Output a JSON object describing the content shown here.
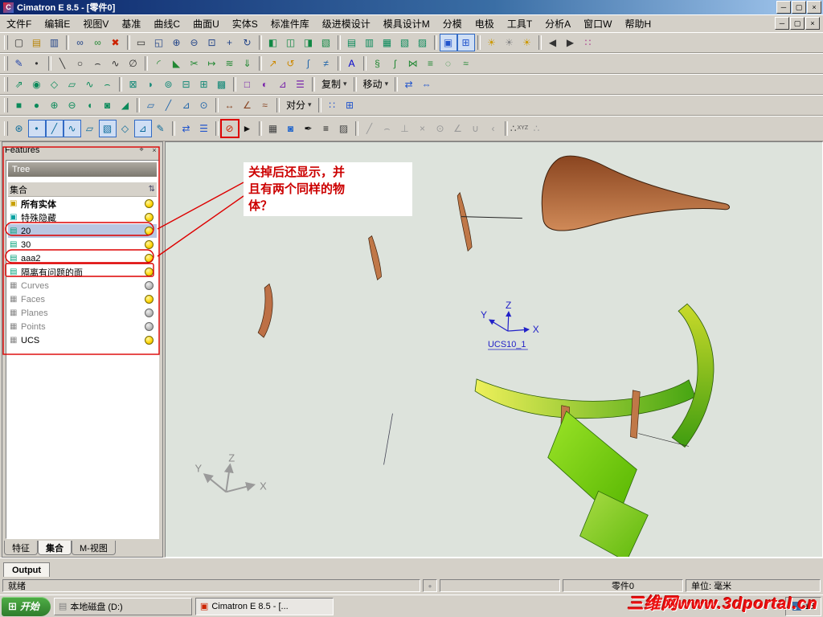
{
  "window": {
    "title": "Cimatron E 8.5 - [零件0]",
    "app_initial": "C"
  },
  "menu": {
    "items": [
      "文件F",
      "编辑E",
      "视图V",
      "基准",
      "曲线C",
      "曲面U",
      "实体S",
      "标准件库",
      "级进模设计",
      "模具设计M",
      "分模",
      "电极",
      "工具T",
      "分析A",
      "窗口W",
      "帮助H"
    ]
  },
  "toolbars": {
    "copy_label": "复制",
    "move_label": "移动",
    "split_label": "对分",
    "row1": [
      {
        "n": "new-file-icon",
        "g": "▢",
        "c": "#333"
      },
      {
        "n": "open-folder-icon",
        "g": "▤",
        "c": "#b8860b"
      },
      {
        "n": "save-icon",
        "g": "▥",
        "c": "#224488"
      },
      {
        "sep": 1
      },
      {
        "n": "link-views-icon",
        "g": "∞",
        "c": "#224488"
      },
      {
        "n": "link-edit-icon",
        "g": "∞",
        "c": "#228833"
      },
      {
        "n": "delete-red-icon",
        "g": "✖",
        "c": "#cc2200"
      },
      {
        "sep": 1
      },
      {
        "n": "select-window-icon",
        "g": "▭",
        "c": "#333"
      },
      {
        "n": "zoom-window-icon",
        "g": "◱",
        "c": "#224488"
      },
      {
        "n": "zoom-in-icon",
        "g": "⊕",
        "c": "#224488"
      },
      {
        "n": "zoom-out-icon",
        "g": "⊖",
        "c": "#224488"
      },
      {
        "n": "zoom-fit-icon",
        "g": "⊡",
        "c": "#224488"
      },
      {
        "n": "pan-icon",
        "g": "+",
        "c": "#224488"
      },
      {
        "n": "rotate-view-icon",
        "g": "↻",
        "c": "#224488"
      },
      {
        "sep": 1
      },
      {
        "n": "shaded-display-icon",
        "g": "◧",
        "c": "#118844"
      },
      {
        "n": "wireframe-display-icon",
        "g": "◫",
        "c": "#118844"
      },
      {
        "n": "hidden-line-display-icon",
        "g": "◨",
        "c": "#118844"
      },
      {
        "n": "perspective-display-icon",
        "g": "▧",
        "c": "#118844"
      },
      {
        "sep": 1
      },
      {
        "n": "part-file-icon",
        "g": "▤",
        "c": "#0a8a5a"
      },
      {
        "n": "assembly-file-icon",
        "g": "▥",
        "c": "#0a8a5a"
      },
      {
        "n": "drawing-file-icon",
        "g": "▦",
        "c": "#0a8a5a"
      },
      {
        "n": "nc-file-icon",
        "g": "▧",
        "c": "#0a8a5a"
      },
      {
        "n": "electrode-file-icon",
        "g": "▨",
        "c": "#0a8a5a"
      },
      {
        "sep": 1
      },
      {
        "n": "single-viewport-icon",
        "g": "▣",
        "c": "#2255cc",
        "a": 1
      },
      {
        "n": "multi-viewport-icon",
        "g": "⊞",
        "c": "#2255cc",
        "a": 1
      },
      {
        "sep": 1
      },
      {
        "n": "light-on-icon",
        "g": "☀",
        "c": "#cc9900"
      },
      {
        "n": "light-off-icon",
        "g": "☀",
        "c": "#888888"
      },
      {
        "n": "light-settings-icon",
        "g": "☀",
        "c": "#cc9900"
      },
      {
        "sep": 1
      },
      {
        "n": "previous-view-icon",
        "g": "◀",
        "c": "#333"
      },
      {
        "n": "next-view-icon",
        "g": "▶",
        "c": "#333"
      },
      {
        "n": "snap-grid-icon",
        "g": "∷",
        "c": "#aa3388"
      }
    ],
    "row2": [
      {
        "n": "sketcher-icon",
        "g": "✎",
        "c": "#2244aa"
      },
      {
        "n": "point-icon",
        "g": "•",
        "c": "#333"
      },
      {
        "sep": 1
      },
      {
        "n": "line-icon",
        "g": "╲",
        "c": "#333"
      },
      {
        "n": "circle-icon",
        "g": "○",
        "c": "#333"
      },
      {
        "n": "arc-icon",
        "g": "⌢",
        "c": "#333"
      },
      {
        "n": "spline-icon",
        "g": "∿",
        "c": "#333"
      },
      {
        "n": "ellipse-icon",
        "g": "∅",
        "c": "#333"
      },
      {
        "sep": 1
      },
      {
        "n": "corner-fillet-icon",
        "g": "◜",
        "c": "#228833"
      },
      {
        "n": "chamfer-icon",
        "g": "◣",
        "c": "#228833"
      },
      {
        "n": "trim-curve-icon",
        "g": "✂",
        "c": "#228833"
      },
      {
        "n": "extend-curve-icon",
        "g": "↦",
        "c": "#228833"
      },
      {
        "n": "offset-curve-icon",
        "g": "≋",
        "c": "#228833"
      },
      {
        "n": "project-curve-icon",
        "g": "⇓",
        "c": "#228833"
      },
      {
        "sep": 1
      },
      {
        "n": "raise-curve-icon",
        "g": "↗",
        "c": "#cc8800"
      },
      {
        "n": "rewind-icon",
        "g": "↺",
        "c": "#cc8800"
      },
      {
        "n": "compose-curve-icon",
        "g": "∫",
        "c": "#2266aa"
      },
      {
        "n": "break-curve-icon",
        "g": "≠",
        "c": "#2266aa"
      },
      {
        "sep": 1
      },
      {
        "n": "text-tool-icon",
        "g": "A",
        "c": "#0000cc"
      },
      {
        "sep": 1
      },
      {
        "n": "helix-icon",
        "g": "§",
        "c": "#228833"
      },
      {
        "n": "curve-3d-icon",
        "g": "ʃ",
        "c": "#228833"
      },
      {
        "n": "intersection-curve-icon",
        "g": "⋈",
        "c": "#228833"
      },
      {
        "n": "iso-curves-icon",
        "g": "≡",
        "c": "#228833"
      },
      {
        "n": "boundary-curve-icon",
        "g": "◌",
        "c": "#228833"
      },
      {
        "n": "flow-curve-icon",
        "g": "≈",
        "c": "#228833"
      }
    ],
    "row3": [
      {
        "n": "extrude-surface-icon",
        "g": "⇗",
        "c": "#0a8a5a"
      },
      {
        "n": "revolve-surface-icon",
        "g": "◉",
        "c": "#0a8a5a"
      },
      {
        "n": "drive-surface-icon",
        "g": "◇",
        "c": "#0a8a5a"
      },
      {
        "n": "ruled-surface-icon",
        "g": "▱",
        "c": "#0a8a5a"
      },
      {
        "n": "sweep-surface-icon",
        "g": "∿",
        "c": "#0a8a5a"
      },
      {
        "n": "blend-surface-icon",
        "g": "⌢",
        "c": "#0a8a5a"
      },
      {
        "sep": 1
      },
      {
        "n": "offset-surface-icon",
        "g": "⊠",
        "c": "#118877"
      },
      {
        "n": "fillet-surface-icon",
        "g": "◗",
        "c": "#118877"
      },
      {
        "n": "extend-surface-icon",
        "g": "⊚",
        "c": "#118877"
      },
      {
        "n": "trim-surface-icon",
        "g": "⊟",
        "c": "#118877"
      },
      {
        "n": "split-surface-icon",
        "g": "⊞",
        "c": "#118877"
      },
      {
        "n": "stitch-surface-icon",
        "g": "▩",
        "c": "#118877"
      },
      {
        "sep": 1
      },
      {
        "n": "untrim-icon",
        "g": "□",
        "c": "#7722aa"
      },
      {
        "n": "silhouette-icon",
        "g": "◐",
        "c": "#7722aa"
      },
      {
        "n": "parting-surface-icon",
        "g": "⊿",
        "c": "#7722aa"
      },
      {
        "n": "flatten-icon",
        "g": "☰",
        "c": "#7722aa"
      },
      {
        "sep": 1
      }
    ],
    "row3b": [
      {
        "n": "mirror-icon",
        "g": "⇄",
        "c": "#2255cc"
      },
      {
        "n": "scale-icon",
        "g": "⇔",
        "c": "#2255cc"
      }
    ],
    "row4": [
      {
        "n": "box-solid-icon",
        "g": "■",
        "c": "#0a8a5a"
      },
      {
        "n": "cylinder-solid-icon",
        "g": "●",
        "c": "#0a8a5a"
      },
      {
        "n": "add-boolean-icon",
        "g": "⊕",
        "c": "#0a8a5a"
      },
      {
        "n": "subtract-boolean-icon",
        "g": "⊖",
        "c": "#0a8a5a"
      },
      {
        "n": "round-solid-icon",
        "g": "◖",
        "c": "#0a8a5a"
      },
      {
        "n": "shell-solid-icon",
        "g": "◙",
        "c": "#0a8a5a"
      },
      {
        "n": "draft-solid-icon",
        "g": "◢",
        "c": "#0a8a5a"
      },
      {
        "sep": 1
      },
      {
        "n": "datum-plane-icon",
        "g": "▱",
        "c": "#2266aa"
      },
      {
        "n": "datum-axis-icon",
        "g": "╱",
        "c": "#2266aa"
      },
      {
        "n": "datum-ucs-icon",
        "g": "⊿",
        "c": "#2266aa"
      },
      {
        "n": "datum-point-icon",
        "g": "⊙",
        "c": "#2266aa"
      },
      {
        "sep": 1
      },
      {
        "n": "measure-icon",
        "g": "↔",
        "c": "#884422"
      },
      {
        "n": "angle-analysis-icon",
        "g": "∠",
        "c": "#884422"
      },
      {
        "n": "curvature-analysis-icon",
        "g": "≈",
        "c": "#884422"
      },
      {
        "sep": 1
      }
    ],
    "row4b": [
      {
        "n": "pattern-icon",
        "g": "∷",
        "c": "#2255cc"
      },
      {
        "n": "array-icon",
        "g": "⊞",
        "c": "#2255cc"
      }
    ],
    "row5": [
      {
        "n": "filter-all-icon",
        "g": "⊛",
        "c": "#0a6a9a"
      },
      {
        "n": "filter-point-icon",
        "g": "•",
        "c": "#0a6a9a",
        "a": 1
      },
      {
        "n": "filter-edge-icon",
        "g": "╱",
        "c": "#0a6a9a",
        "a": 1
      },
      {
        "n": "filter-curve-icon",
        "g": "∿",
        "c": "#0a6a9a",
        "a": 1
      },
      {
        "n": "filter-face-icon",
        "g": "▱",
        "c": "#0a6a9a"
      },
      {
        "n": "filter-solid-icon",
        "g": "▧",
        "c": "#0a6a9a",
        "a": 1
      },
      {
        "n": "filter-plane-icon",
        "g": "◇",
        "c": "#0a6a9a"
      },
      {
        "n": "filter-ucs-icon",
        "g": "⊿",
        "c": "#0a6a9a",
        "a": 1
      },
      {
        "n": "filter-sketch-icon",
        "g": "✎",
        "c": "#0a6a9a"
      },
      {
        "sep": 1
      },
      {
        "n": "sync-select-icon",
        "g": "⇄",
        "c": "#2255cc"
      },
      {
        "n": "list-select-icon",
        "g": "☰",
        "c": "#2255cc"
      },
      {
        "sep": 1
      },
      {
        "n": "no-snap-icon",
        "g": "⊘",
        "c": "#cc2200",
        "r": 1
      },
      {
        "n": "pick-cursor-icon",
        "g": "►",
        "c": "#111"
      },
      {
        "sep": 1
      },
      {
        "n": "grid-table-icon",
        "g": "▦",
        "c": "#444"
      },
      {
        "n": "color-fill-icon",
        "g": "◙",
        "c": "#2266cc"
      },
      {
        "n": "pen-icon",
        "g": "✒",
        "c": "#111"
      },
      {
        "n": "line-width-icon",
        "g": "≡",
        "c": "#111"
      },
      {
        "n": "hatch-pattern-icon",
        "g": "▨",
        "c": "#444"
      },
      {
        "sep": 1
      },
      {
        "n": "ghost-line-icon",
        "g": "╱",
        "c": "#999"
      },
      {
        "n": "ghost-arc-icon",
        "g": "⌢",
        "c": "#999"
      },
      {
        "n": "ghost-perp-icon",
        "g": "⊥",
        "c": "#999"
      },
      {
        "n": "ghost-cross-icon",
        "g": "×",
        "c": "#999"
      },
      {
        "n": "ghost-circle-icon",
        "g": "⊙",
        "c": "#999"
      },
      {
        "n": "ghost-angle-icon",
        "g": "∠",
        "c": "#999"
      },
      {
        "n": "ghost-union-icon",
        "g": "∪",
        "c": "#999"
      },
      {
        "n": "ghost-bracket-icon",
        "g": "‹",
        "c": "#999"
      },
      {
        "sep": 1
      },
      {
        "n": "xyz-coords-icon",
        "g": "∴",
        "c": "#444",
        "t": "XYZ"
      },
      {
        "n": "delta-coords-icon",
        "g": "∴",
        "c": "#999"
      }
    ]
  },
  "features": {
    "title": "Features",
    "caption": "Tree",
    "rows": [
      {
        "label": "集合",
        "header": true
      },
      {
        "label": "所有实体",
        "bold": true,
        "bulb": "yellow",
        "g": "▣",
        "iconColor": "#c8a000"
      },
      {
        "label": "特殊隐藏",
        "bulb": "yellow",
        "g": "▣",
        "iconColor": "#00a0a0"
      },
      {
        "label": "20",
        "bulb": "yellow",
        "selected": true,
        "g": "▤",
        "iconColor": "#00a078"
      },
      {
        "label": "30",
        "bulb": "yellow",
        "g": "▤",
        "iconColor": "#00a078"
      },
      {
        "label": "aaa2",
        "bulb": "yellow",
        "g": "▤",
        "iconColor": "#00a078"
      },
      {
        "label": "隔离有问题的面",
        "bulb": "yellow",
        "g": "▤",
        "iconColor": "#00a078"
      },
      {
        "label": "Curves",
        "dim": true,
        "bulb": "gray",
        "g": "▦",
        "iconColor": "#8a8a8a"
      },
      {
        "label": "Faces",
        "dim": true,
        "bulb": "yellow",
        "g": "▦",
        "iconColor": "#8a8a8a"
      },
      {
        "label": "Planes",
        "dim": true,
        "bulb": "gray",
        "g": "▦",
        "iconColor": "#8a8a8a"
      },
      {
        "label": "Points",
        "dim": true,
        "bulb": "gray",
        "g": "▦",
        "iconColor": "#8a8a8a"
      },
      {
        "label": "UCS",
        "bulb": "yellow",
        "g": "▦",
        "iconColor": "#8a8a8a"
      }
    ],
    "tabs": [
      {
        "label": "特征"
      },
      {
        "label": "集合",
        "active": true
      },
      {
        "label": "M-视图"
      }
    ]
  },
  "annotation": {
    "line1": "关掉后还显示，并",
    "line2": "且有两个同样的物",
    "line3": "体？"
  },
  "viewport": {
    "axes": {
      "x": "X",
      "y": "Y",
      "z": "Z"
    },
    "ucs_name": "UCS10_1"
  },
  "output": {
    "tab_label": "Output"
  },
  "statusbar": {
    "ready": "就绪",
    "doc_name": "零件0",
    "units": "单位: 毫米"
  },
  "taskbar": {
    "start_label": "开始",
    "buttons": [
      {
        "label": "本地磁盘 (D:)",
        "g": "▤",
        "iconColor": "#808080"
      },
      {
        "label": "Cimatron E 8.5 - [...",
        "g": "▣",
        "iconColor": "#cc2200",
        "active": true
      }
    ],
    "watermark": "三维网www.3dportal.cn",
    "tray_time": "16"
  },
  "colors": {
    "accent_selection": "#b9c7e2",
    "annotation_red": "#dd0000",
    "surface_brown": "#c07848",
    "surface_green": "#54b400",
    "viewport_bg": "#dde3dc"
  }
}
